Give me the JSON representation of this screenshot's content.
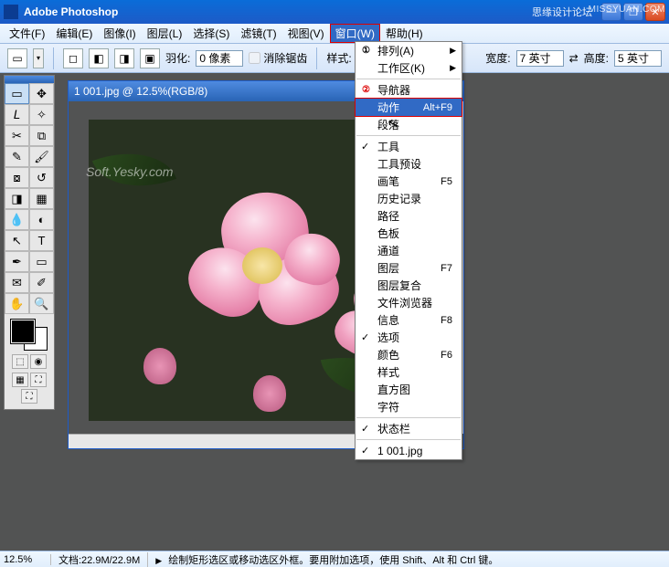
{
  "app": {
    "title": "Adobe Photoshop",
    "watermark_forum": "思缘设计论坛",
    "watermark_url": "MISSYUAN.COM"
  },
  "winbtns": {
    "min": "—",
    "max": "❐",
    "close": "✕"
  },
  "menubar": [
    {
      "label": "文件(F)"
    },
    {
      "label": "编辑(E)"
    },
    {
      "label": "图像(I)"
    },
    {
      "label": "图层(L)"
    },
    {
      "label": "选择(S)"
    },
    {
      "label": "滤镜(T)"
    },
    {
      "label": "视图(V)"
    },
    {
      "label": "窗口(W)",
      "active": true
    },
    {
      "label": "帮助(H)"
    }
  ],
  "options": {
    "feather_label": "羽化:",
    "feather_value": "0 像素",
    "antialias_label": "消除锯齿",
    "style_label": "样式:",
    "width_label": "宽度:",
    "width_value": "7 英寸",
    "height_label": "高度:",
    "height_value": "5 英寸",
    "swap_icon": "⇄"
  },
  "doc": {
    "title": "1 001.jpg @ 12.5%(RGB/8)",
    "soft_watermark": "Soft.Yesky.com"
  },
  "dropdown": {
    "items": [
      {
        "label": "排列(A)",
        "has_sub": true,
        "num": "①"
      },
      {
        "label": "工作区(K)",
        "has_sub": true
      },
      {
        "sep": true
      },
      {
        "label": "导航器",
        "num": "②",
        "num_red": true
      },
      {
        "label": "动作",
        "shortcut": "Alt+F9",
        "highlight": true
      },
      {
        "label": "段落"
      },
      {
        "sep": true
      },
      {
        "label": "工具",
        "checked": true
      },
      {
        "label": "工具预设"
      },
      {
        "label": "画笔",
        "shortcut": "F5"
      },
      {
        "label": "历史记录"
      },
      {
        "label": "路径"
      },
      {
        "label": "色板"
      },
      {
        "label": "通道"
      },
      {
        "label": "图层",
        "shortcut": "F7"
      },
      {
        "label": "图层复合"
      },
      {
        "label": "文件浏览器"
      },
      {
        "label": "信息",
        "shortcut": "F8"
      },
      {
        "label": "选项",
        "checked": true
      },
      {
        "label": "颜色",
        "shortcut": "F6"
      },
      {
        "label": "样式"
      },
      {
        "label": "直方图"
      },
      {
        "label": "字符"
      },
      {
        "sep": true
      },
      {
        "label": "状态栏",
        "checked": true
      },
      {
        "sep": true
      },
      {
        "label": "1 001.jpg",
        "checked": true
      }
    ]
  },
  "tools": [
    {
      "name": "marquee",
      "g": "▭",
      "sel": true
    },
    {
      "name": "move",
      "g": "✥"
    },
    {
      "name": "lasso",
      "g": "𝘓"
    },
    {
      "name": "wand",
      "g": "✧"
    },
    {
      "name": "crop",
      "g": "✂"
    },
    {
      "name": "slice",
      "g": "⧉"
    },
    {
      "name": "heal",
      "g": "✎"
    },
    {
      "name": "brush",
      "g": "🖌"
    },
    {
      "name": "stamp",
      "g": "⧇"
    },
    {
      "name": "history-brush",
      "g": "↺"
    },
    {
      "name": "eraser",
      "g": "◨"
    },
    {
      "name": "gradient",
      "g": "▦"
    },
    {
      "name": "blur",
      "g": "💧"
    },
    {
      "name": "dodge",
      "g": "◐"
    },
    {
      "name": "path-sel",
      "g": "↖"
    },
    {
      "name": "type",
      "g": "T"
    },
    {
      "name": "pen",
      "g": "✒"
    },
    {
      "name": "shape",
      "g": "▭"
    },
    {
      "name": "notes",
      "g": "✉"
    },
    {
      "name": "eyedrop",
      "g": "✐"
    },
    {
      "name": "hand",
      "g": "✋"
    },
    {
      "name": "zoom",
      "g": "🔍"
    }
  ],
  "mini_modes": {
    "a": "⬚",
    "b": "◉",
    "c": "▦",
    "d": "⛶"
  },
  "status": {
    "zoom": "12.5%",
    "docinfo": "文档:22.9M/22.9M",
    "hint_arrow": "▶",
    "hint": "绘制矩形选区或移动选区外框。要用附加选项，使用 Shift、Alt 和 Ctrl 键。"
  }
}
